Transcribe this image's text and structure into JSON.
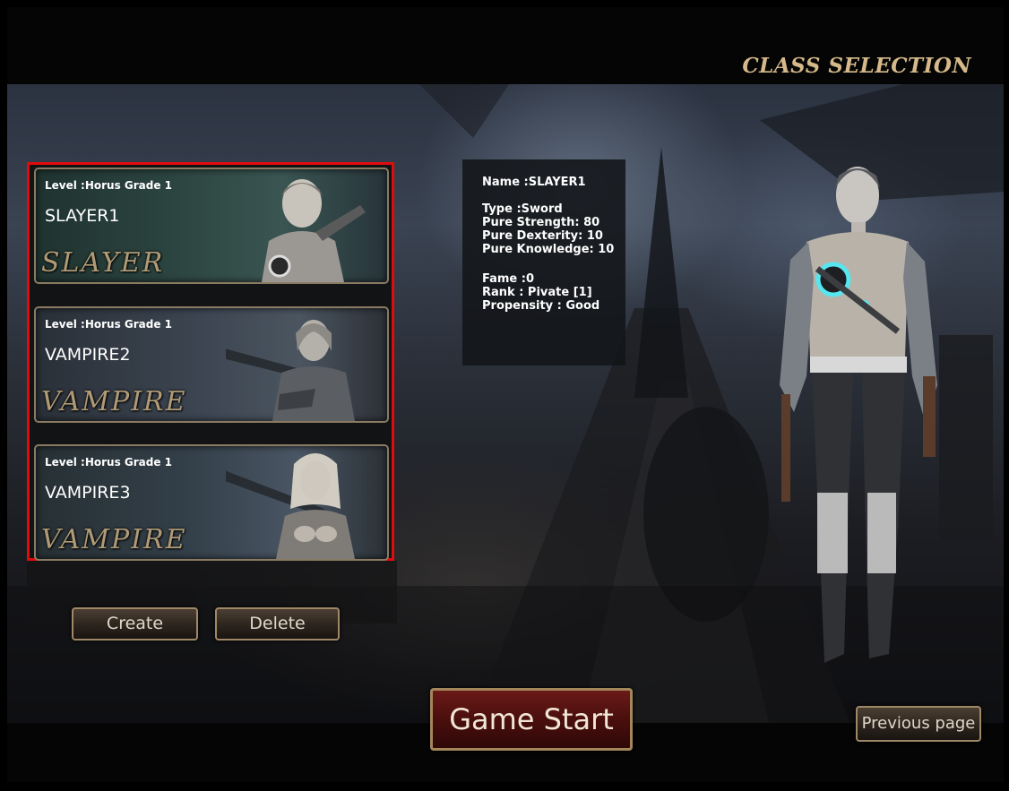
{
  "header": {
    "title": "CLASS SELECTION"
  },
  "characters": [
    {
      "level": "Level :Horus Grade 1",
      "name": "SLAYER1",
      "class_art": "SLAYER",
      "selected": true
    },
    {
      "level": "Level :Horus Grade 1",
      "name": "VAMPIRE2",
      "class_art": "VAMPIRE",
      "selected": false
    },
    {
      "level": "Level :Horus Grade 1",
      "name": "VAMPIRE3",
      "class_art": "VAMPIRE",
      "selected": false
    }
  ],
  "info": {
    "name": "Name :SLAYER1",
    "type": "Type :Sword",
    "strength": "Pure Strength: 80",
    "dexterity": "Pure Dexterity: 10",
    "knowledge": "Pure Knowledge: 10",
    "fame": "Fame :0",
    "rank": "Rank : Pivate [1]",
    "propensity": "Propensity : Good"
  },
  "buttons": {
    "create": "Create",
    "delete": "Delete",
    "game_start": "Game Start",
    "previous_page": "Previous page"
  },
  "colors": {
    "selection_border": "#e10b0b",
    "title_gold": "#d5b98a",
    "start_red": "#5a1412"
  }
}
